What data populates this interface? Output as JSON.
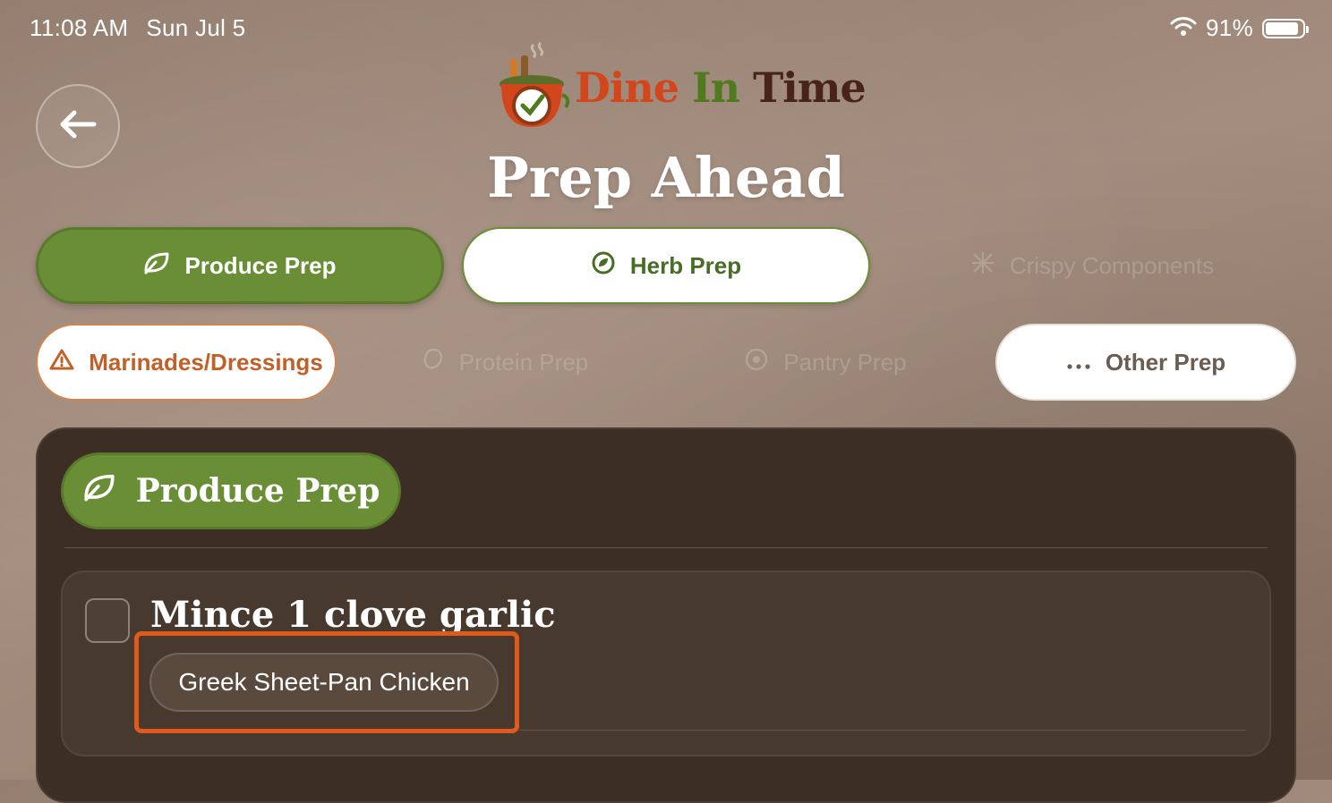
{
  "status_bar": {
    "time": "11:08 AM",
    "date": "Sun Jul 5",
    "battery": "91%"
  },
  "logo": {
    "word1": "Dine",
    "word2": "In",
    "word3": "Time"
  },
  "page": {
    "title": "Prep Ahead"
  },
  "categories": {
    "produce": "Produce Prep",
    "herb": "Herb Prep",
    "crispy": "Crispy Components",
    "marinades": "Marinades/Dressings",
    "protein": "Protein Prep",
    "pantry": "Pantry Prep",
    "other": "Other Prep"
  },
  "section": {
    "title": "Produce Prep"
  },
  "tasks": [
    {
      "title": "Mince 1 clove garlic",
      "recipe": "Greek Sheet-Pan Chicken",
      "checked": false
    }
  ],
  "colors": {
    "accent_green": "#6a8e35",
    "accent_orange": "#c0612a",
    "highlight": "#e05a1c",
    "panel": "#3c2e24"
  }
}
